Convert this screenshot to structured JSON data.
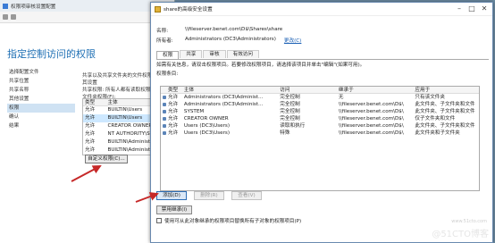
{
  "background_window": {
    "title": "权限项审核设置配置",
    "heading": "指定控制访问的权限",
    "nav": [
      "选择配置文件",
      "共享位置",
      "共享名称",
      "其他设置",
      "权限",
      "确认",
      "结果"
    ],
    "nav_active_index": 4,
    "description": [
      "共享以及共享文件夹的文件权限，应将其设置",
      "共享权限: 所有人都有读取权限",
      "文件夹权限(F):"
    ],
    "list_headers": [
      "类型",
      "主体"
    ],
    "list_rows": [
      {
        "type": "允许",
        "principal": "BUILTIN\\Users"
      },
      {
        "type": "允许",
        "principal": "BUILTIN\\Users"
      },
      {
        "type": "允许",
        "principal": "CREATOR OWNER"
      },
      {
        "type": "允许",
        "principal": "NT AUTHORITY\\SY"
      },
      {
        "type": "允许",
        "principal": "BUILTIN\\Administr"
      },
      {
        "type": "允许",
        "principal": "BUILTIN\\Administr"
      }
    ],
    "custom_permissions_button": "自定义权限(C)..."
  },
  "dialog": {
    "title": "share的高级安全设置",
    "name_label": "名称:",
    "name_value": "\\\\fileserver.benet.com\\D$\\Shares\\share",
    "owner_label": "所有者:",
    "owner_value": "Administrators (DC3\\Administrators)",
    "owner_change_link": "更改(C)",
    "tabs": [
      "权限",
      "共享",
      "审核",
      "有效访问"
    ],
    "active_tab": 0,
    "info_text": "如需有关信息，请双击权限项目。若要修改权限项目，请选择该项目并单击\"编辑\"(如果可用)。",
    "perm_list_label": "权限条目:",
    "columns": [
      "类型",
      "主体",
      "访问",
      "继承于",
      "应用于"
    ],
    "rows": [
      {
        "type": "允许",
        "principal": "Administrators (DC3\\Administ...",
        "access": "完全控制",
        "inherited": "无",
        "applies": "只有该文件夹"
      },
      {
        "type": "允许",
        "principal": "Administrators (DC3\\Administ...",
        "access": "完全控制",
        "inherited": "\\\\fileserver.benet.com\\D$\\",
        "applies": "此文件夹、子文件夹和文件"
      },
      {
        "type": "允许",
        "principal": "SYSTEM",
        "access": "完全控制",
        "inherited": "\\\\fileserver.benet.com\\D$\\",
        "applies": "此文件夹、子文件夹和文件"
      },
      {
        "type": "允许",
        "principal": "CREATOR OWNER",
        "access": "完全控制",
        "inherited": "\\\\fileserver.benet.com\\D$\\",
        "applies": "仅子文件夹和文件"
      },
      {
        "type": "允许",
        "principal": "Users (DC3\\Users)",
        "access": "读取和执行",
        "inherited": "\\\\fileserver.benet.com\\D$\\",
        "applies": "此文件夹、子文件夹和文件"
      },
      {
        "type": "允许",
        "principal": "Users (DC3\\Users)",
        "access": "特殊",
        "inherited": "\\\\fileserver.benet.com\\D$\\",
        "applies": "此文件夹和子文件夹"
      }
    ],
    "buttons": {
      "add": "添加(D)",
      "remove": "删除(R)",
      "view": "查看(V)"
    },
    "disable_inheritance": "禁用继承(I)",
    "checkbox_label": "使用可从此对象继承的权限项目替换所有子对象的权限项目(P)",
    "checkbox_checked": false
  },
  "watermark": {
    "text": "@51CTO博客",
    "sub": "www.51cto.com"
  }
}
